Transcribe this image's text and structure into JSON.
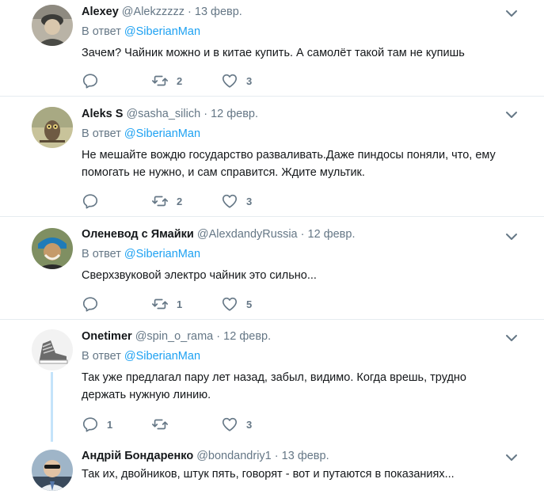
{
  "mention_prefix": "В ответ ",
  "tweets": [
    {
      "name": "Alexey",
      "handle": "@Alekzzzzz",
      "date": "13 февр.",
      "reply_to": "@SiberianMan",
      "text": "Зачем? Чайник можно и в китае купить. А самолёт такой там не купишь",
      "replies": "",
      "retweets": "2",
      "likes": "3"
    },
    {
      "name": "Aleks S",
      "handle": "@sasha_silich",
      "date": "12 февр.",
      "reply_to": "@SiberianMan",
      "text": "Не мешайте вождю государство разваливать.Даже пиндосы поняли, что, ему помогать не нужно, и сам справится. Ждите мультик.",
      "replies": "",
      "retweets": "2",
      "likes": "3"
    },
    {
      "name": "Оленевод с Ямайки",
      "handle": "@AlexdandyRussia",
      "date": "12 февр.",
      "reply_to": "@SiberianMan",
      "text": "Сверхзвуковой электро чайник это сильно...",
      "replies": "",
      "retweets": "1",
      "likes": "5"
    },
    {
      "name": "Onetimer",
      "handle": "@spin_o_rama",
      "date": "12 февр.",
      "reply_to": "@SiberianMan",
      "text": "Так уже предлагал пару лет назад, забыл, видимо. Когда врешь, трудно держать нужную линию.",
      "replies": "1",
      "retweets": "",
      "likes": "3"
    },
    {
      "name": "Андрій Бондаренко",
      "handle": "@bondandriy1",
      "date": "13 февр.",
      "text": "Так их, двойников, штук пять, говорят - вот и путаются в показаниях..."
    }
  ],
  "colors": {
    "accent": "#1da1f2",
    "text": "#14171a",
    "secondary": "#657786",
    "separator": "#e6ecf0",
    "thread_line": "#c4e3fa"
  },
  "icons": {
    "reply": "reply-icon",
    "retweet": "retweet-icon",
    "like": "heart-icon",
    "menu": "chevron-down-icon"
  }
}
